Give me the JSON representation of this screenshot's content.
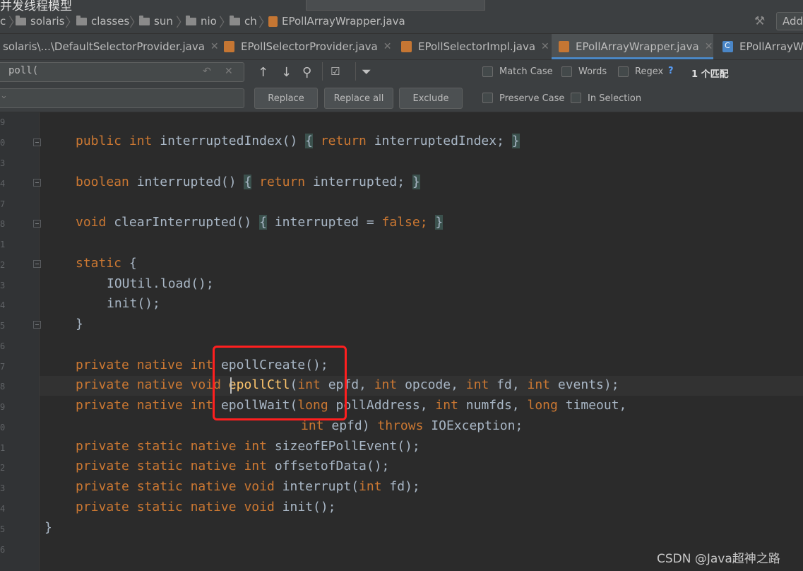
{
  "title_overlay": "并发线程模型",
  "breadcrumb": [
    "c",
    "solaris",
    "classes",
    "sun",
    "nio",
    "ch",
    "EPollArrayWrapper.java"
  ],
  "add_button": "Add",
  "tabs": [
    {
      "label": "solaris\\...\\DefaultSelectorProvider.java"
    },
    {
      "label": "EPollSelectorProvider.java"
    },
    {
      "label": "EPollSelectorImpl.java"
    },
    {
      "label": "EPollArrayWrapper.java"
    },
    {
      "label": "EPollArrayW"
    }
  ],
  "find": {
    "search_value": "poll(",
    "replace_value": "",
    "buttons": {
      "replace": "Replace",
      "replace_all": "Replace all",
      "exclude": "Exclude"
    },
    "options": {
      "match_case": "Match Case",
      "words": "Words",
      "regex": "Regex",
      "regex_help": "?",
      "preserve_case": "Preserve Case",
      "in_selection": "In Selection"
    },
    "match_count": "1 个匹配"
  },
  "line_numbers": [
    "9",
    "0",
    "3",
    "4",
    "7",
    "8",
    "1",
    "2",
    "3",
    "4",
    "5",
    "6",
    "7",
    "8",
    "9",
    "0",
    "1",
    "2",
    "3",
    "4",
    "5",
    "6"
  ],
  "code": {
    "l1": {
      "kw1": "public",
      "kw2": "int",
      "name": "interruptedIndex()",
      "b1": "{",
      "kw3": "return",
      "rest": "interruptedIndex;",
      "b2": "}"
    },
    "l2": {
      "kw1": "boolean",
      "name": "interrupted()",
      "b1": "{",
      "kw3": "return",
      "rest": "interrupted;",
      "b2": "}"
    },
    "l3": {
      "kw1": "void",
      "name": "clearInterrupted()",
      "b1": "{",
      "rest": "interrupted = ",
      "kw2": "false",
      "semi": ";",
      "b2": "}"
    },
    "l4": {
      "kw1": "static",
      "rest": "{"
    },
    "l5": {
      "text": "IOUtil.load();"
    },
    "l6": {
      "text": "init();"
    },
    "l7": {
      "text": "}"
    },
    "l8": {
      "kw1": "private",
      "kw2": "native",
      "kw3": "int",
      "fn": "epollCreate",
      "rest": "();"
    },
    "l9": {
      "kw1": "private",
      "kw2": "native",
      "kw3": "void",
      "fn": "epollCtl",
      "rest_a": "(",
      "kw4": "int",
      "rest_b": "epfd, ",
      "kw5": "int",
      "rest_c": "opcode, ",
      "kw6": "int",
      "rest_d": "fd, ",
      "kw7": "int",
      "rest_e": "events);"
    },
    "l10": {
      "kw1": "private",
      "kw2": "native",
      "kw3": "int",
      "fn": "epollWait",
      "rest_a": "(",
      "kw4": "long",
      "rest_b": "pollAddress, ",
      "kw5": "int",
      "rest_c": "numfds, ",
      "kw6": "long",
      "rest_d": "timeout,"
    },
    "l11": {
      "kw1": "int",
      "rest_a": "epfd) ",
      "kw2": "throws",
      "rest_b": "IOException;"
    },
    "l12": {
      "kw1": "private",
      "kw2": "static",
      "kw3": "native",
      "kw4": "int",
      "rest": "sizeofEPollEvent();"
    },
    "l13": {
      "kw1": "private",
      "kw2": "static",
      "kw3": "native",
      "kw4": "int",
      "rest": "offsetofData();"
    },
    "l14": {
      "kw1": "private",
      "kw2": "static",
      "kw3": "native",
      "kw4": "void",
      "rest_a": "interrupt(",
      "kw5": "int",
      "rest_b": "fd);"
    },
    "l15": {
      "kw1": "private",
      "kw2": "static",
      "kw3": "native",
      "kw4": "void",
      "rest": "init();"
    },
    "l16": {
      "text": "}"
    }
  },
  "watermark": "CSDN @Java超神之路"
}
